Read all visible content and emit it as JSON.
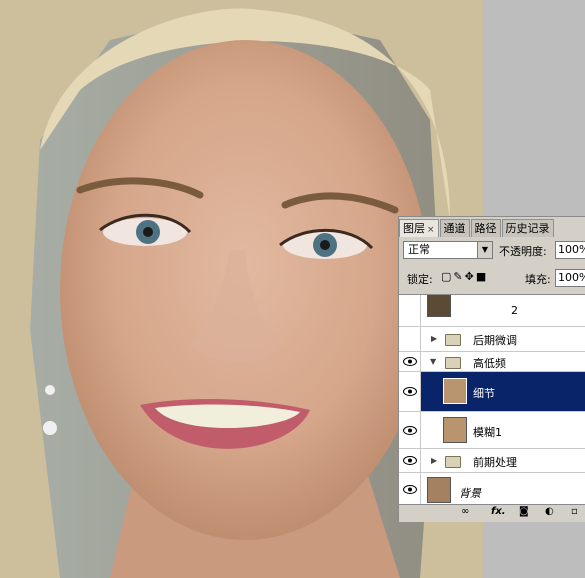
{
  "panel": {
    "tabs": [
      {
        "label": "图层",
        "close": "×"
      },
      {
        "label": "通道"
      },
      {
        "label": "路径"
      },
      {
        "label": "历史记录"
      }
    ],
    "blend_mode": "正常",
    "opacity_label": "不透明度:",
    "opacity_value": "100%",
    "lock_label": "锁定:",
    "fill_label": "填充:",
    "fill_value": "100%",
    "layers": [
      {
        "name": "2",
        "type": "layer",
        "visible": false
      },
      {
        "name": "后期微调",
        "type": "group",
        "visible": false
      },
      {
        "name": "高低频",
        "type": "group",
        "expanded": true,
        "visible": true
      },
      {
        "name": "细节",
        "type": "layer",
        "selected": true,
        "visible": true
      },
      {
        "name": "模糊1",
        "type": "layer",
        "visible": true
      },
      {
        "name": "前期处理",
        "type": "group",
        "visible": true
      },
      {
        "name": "背景",
        "type": "layer",
        "visible": true
      }
    ],
    "bottom_icons": [
      "link-icon",
      "fx-icon",
      "mask-icon",
      "adjustment-icon",
      "new-layer-icon"
    ],
    "fx_label": "fx."
  },
  "colors": {
    "selection": "#0a246a",
    "panel_bg": "#d4d0c8"
  }
}
